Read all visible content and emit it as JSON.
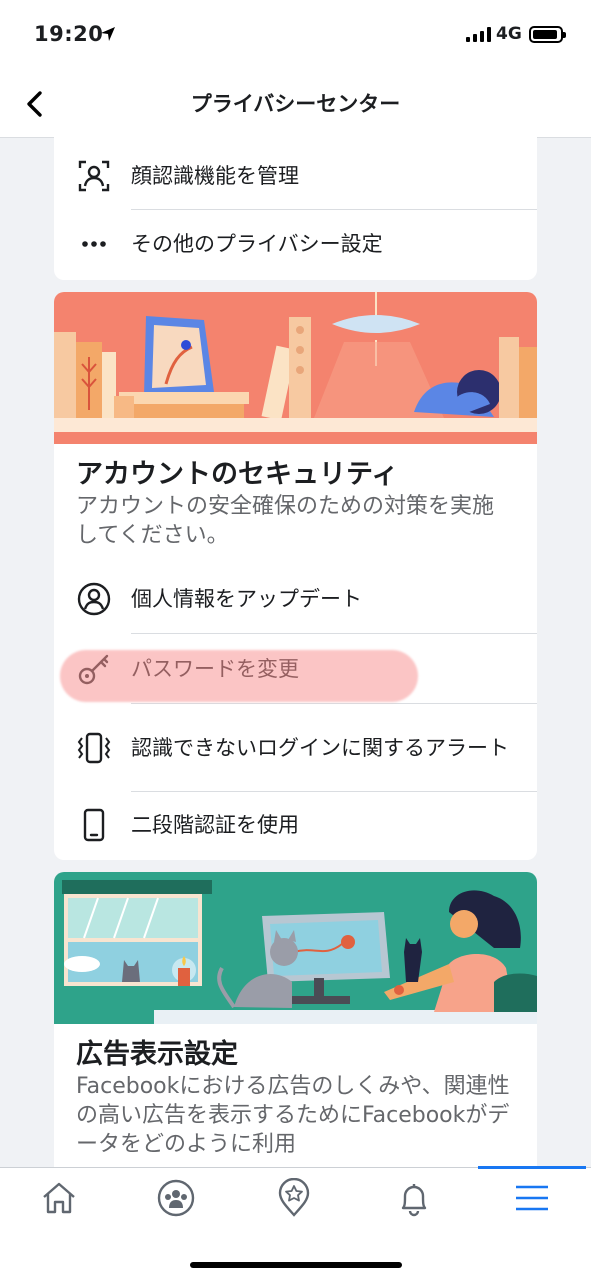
{
  "status_bar": {
    "time": "19:20",
    "network": "4G"
  },
  "nav": {
    "title": "プライバシーセンター"
  },
  "top_card": {
    "items": [
      {
        "label": "顔認識機能を管理",
        "icon": "face-recognition-icon"
      },
      {
        "label": "その他のプライバシー設定",
        "icon": "more-dots-icon"
      }
    ]
  },
  "security_card": {
    "title": "アカウントのセキュリティ",
    "description": "アカウントの安全確保のための対策を実施してください。",
    "items": [
      {
        "label": "個人情報をアップデート",
        "icon": "user-circle-icon"
      },
      {
        "label": "パスワードを変更",
        "icon": "key-icon"
      },
      {
        "label": "認識できないログインに関するアラート",
        "icon": "phone-vibrate-icon"
      },
      {
        "label": "二段階認証を使用",
        "icon": "phone-icon"
      }
    ]
  },
  "ads_card": {
    "title": "広告表示設定",
    "description": "Facebookにおける広告のしくみや、関連性の高い広告を表示するためにFacebookがデータをどのように利用"
  },
  "tabs": [
    "home-icon",
    "groups-icon",
    "pages-icon",
    "notifications-icon",
    "menu-icon"
  ],
  "colors": {
    "accent": "#1877f2",
    "security_banner_bg": "#f4836e",
    "ads_banner_bg": "#2ea38a",
    "highlight": "#f89696"
  }
}
